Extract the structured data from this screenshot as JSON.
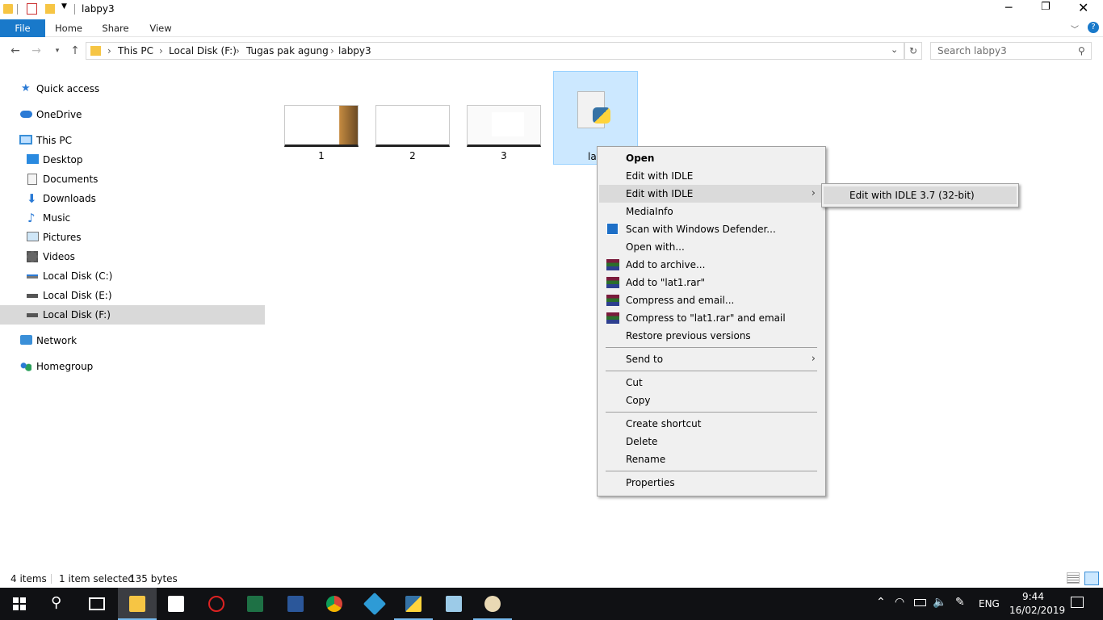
{
  "window": {
    "title": "labpy3"
  },
  "ribbon": {
    "tabs": [
      "File",
      "Home",
      "Share",
      "View"
    ]
  },
  "address": {
    "crumbs": [
      "This PC",
      "Local Disk (F:)",
      "Tugas pak agung",
      "labpy3"
    ],
    "search_placeholder": "Search labpy3"
  },
  "sidebar": {
    "items": [
      {
        "label": "Quick access",
        "icon": "star-icon"
      },
      {
        "label": "OneDrive",
        "icon": "cloud-icon"
      },
      {
        "label": "This PC",
        "icon": "computer-icon"
      },
      {
        "label": "Desktop",
        "icon": "desktop-icon"
      },
      {
        "label": "Documents",
        "icon": "documents-icon"
      },
      {
        "label": "Downloads",
        "icon": "download-icon"
      },
      {
        "label": "Music",
        "icon": "music-icon"
      },
      {
        "label": "Pictures",
        "icon": "pictures-icon"
      },
      {
        "label": "Videos",
        "icon": "videos-icon"
      },
      {
        "label": "Local Disk (C:)",
        "icon": "drive-icon"
      },
      {
        "label": "Local Disk (E:)",
        "icon": "drive-icon"
      },
      {
        "label": "Local Disk (F:)",
        "icon": "drive-icon",
        "selected": true
      },
      {
        "label": "Network",
        "icon": "network-icon"
      },
      {
        "label": "Homegroup",
        "icon": "homegroup-icon"
      }
    ]
  },
  "files": [
    {
      "name": "1"
    },
    {
      "name": "2"
    },
    {
      "name": "3"
    },
    {
      "name": "lat1",
      "visible_name": "lat",
      "selected": true
    }
  ],
  "context_menu": {
    "items": [
      {
        "label": "Open",
        "bold": true
      },
      {
        "label": "Edit with IDLE"
      },
      {
        "label": "Edit with IDLE",
        "submenu": true,
        "highlighted": true
      },
      {
        "label": "MediaInfo"
      },
      {
        "label": "Scan with Windows Defender...",
        "icon": "defender-icon"
      },
      {
        "label": "Open with..."
      },
      {
        "label": "Add to archive...",
        "icon": "winrar-icon"
      },
      {
        "label": "Add to \"lat1.rar\"",
        "icon": "winrar-icon"
      },
      {
        "label": "Compress and email...",
        "icon": "winrar-icon"
      },
      {
        "label": "Compress to \"lat1.rar\" and email",
        "icon": "winrar-icon"
      },
      {
        "label": "Restore previous versions"
      },
      {
        "label": "Send to",
        "submenu": true
      },
      {
        "label": "Cut"
      },
      {
        "label": "Copy"
      },
      {
        "label": "Create shortcut"
      },
      {
        "label": "Delete"
      },
      {
        "label": "Rename"
      },
      {
        "label": "Properties"
      }
    ],
    "submenu": {
      "label": "Edit with IDLE 3.7 (32-bit)"
    }
  },
  "status": {
    "items": "4 items",
    "selection": "1 item selected",
    "size": "135 bytes"
  },
  "taskbar": {
    "time": "9:44",
    "date": "16/02/2019",
    "lang": "ENG"
  },
  "colors": {
    "accent": "#1979ca",
    "selection": "#cce8ff",
    "taskbar": "#101114"
  }
}
